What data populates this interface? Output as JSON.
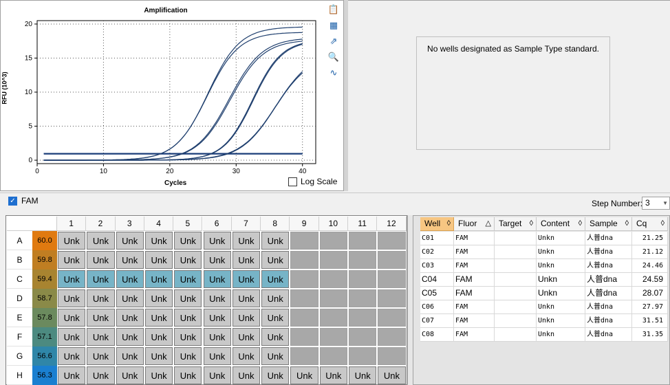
{
  "chart_data": {
    "type": "line",
    "title": "Amplification",
    "xlabel": "Cycles",
    "ylabel": "RFU (10^3)",
    "xlim": [
      0,
      42
    ],
    "ylim": [
      -0.5,
      20.5
    ],
    "xticks": [
      0,
      10,
      20,
      30,
      40
    ],
    "yticks": [
      0,
      5,
      10,
      15,
      20
    ],
    "grid": true,
    "series": [
      {
        "well": "C01",
        "cq": 21.25,
        "plateau": 19.6,
        "slope": 2.4
      },
      {
        "well": "C02",
        "cq": 21.12,
        "plateau": 18.8,
        "slope": 2.4
      },
      {
        "well": "C03",
        "cq": 24.46,
        "plateau": 18.0,
        "slope": 2.5
      },
      {
        "well": "C04",
        "cq": 24.59,
        "plateau": 17.7,
        "slope": 2.5
      },
      {
        "well": "C05",
        "cq": 28.07,
        "plateau": 17.6,
        "slope": 2.2
      },
      {
        "well": "C06",
        "cq": 27.97,
        "plateau": 17.7,
        "slope": 2.2
      },
      {
        "well": "C07",
        "cq": 31.51,
        "plateau": 16.0,
        "slope": 2.7
      },
      {
        "well": "C08",
        "cq": 31.35,
        "plateau": 15.4,
        "slope": 2.6
      }
    ],
    "baselines": [
      1.0,
      1.0,
      0.9
    ],
    "line_color": "#1f3f6e",
    "baseline_color": "#1a3d78"
  },
  "chart_ui": {
    "log_scale_label": "Log Scale",
    "log_scale_checked": false,
    "tools": [
      "copy-icon",
      "chart-type-icon",
      "export-icon",
      "zoom-icon",
      "curve-fit-icon"
    ]
  },
  "standard_panel": {
    "message": "No wells designated as Sample Type standard."
  },
  "fluor_toggle": {
    "label": "FAM",
    "checked": true
  },
  "step": {
    "label": "Step Number:",
    "value": "3"
  },
  "plate": {
    "columns": [
      "1",
      "2",
      "3",
      "4",
      "5",
      "6",
      "7",
      "8",
      "9",
      "10",
      "11",
      "12"
    ],
    "rows": [
      {
        "letter": "A",
        "temp": "60.0",
        "color": "#e07a10",
        "used": 8
      },
      {
        "letter": "B",
        "temp": "59.8",
        "color": "#c07e22",
        "used": 8
      },
      {
        "letter": "C",
        "temp": "59.4",
        "color": "#a88430",
        "used": 8
      },
      {
        "letter": "D",
        "temp": "58.7",
        "color": "#8a8a48",
        "used": 8
      },
      {
        "letter": "E",
        "temp": "57.8",
        "color": "#6b8a5e",
        "used": 8
      },
      {
        "letter": "F",
        "temp": "57.1",
        "color": "#4c8a80",
        "used": 8
      },
      {
        "letter": "G",
        "temp": "56.6",
        "color": "#2f86a8",
        "used": 8
      },
      {
        "letter": "H",
        "temp": "56.3",
        "color": "#1a7fd0",
        "used": 12
      }
    ],
    "well_label": "Unk",
    "selected_row": "C"
  },
  "table": {
    "headers": [
      "Well",
      "Fluor",
      "Target",
      "Content",
      "Sample",
      "Cq"
    ],
    "sorted_column": "Well",
    "rows": [
      [
        "C01",
        "FAM",
        "",
        "Unkn",
        "人普dna",
        "21.25"
      ],
      [
        "C02",
        "FAM",
        "",
        "Unkn",
        "人普dna",
        "21.12"
      ],
      [
        "C03",
        "FAM",
        "",
        "Unkn",
        "人普dna",
        "24.46"
      ],
      [
        "C04",
        "FAM",
        "",
        "Unkn",
        "人普dna",
        "24.59"
      ],
      [
        "C05",
        "FAM",
        "",
        "Unkn",
        "人普dna",
        "28.07"
      ],
      [
        "C06",
        "FAM",
        "",
        "Unkn",
        "人普dna",
        "27.97"
      ],
      [
        "C07",
        "FAM",
        "",
        "Unkn",
        "人普dna",
        "31.51"
      ],
      [
        "C08",
        "FAM",
        "",
        "Unkn",
        "人普dna",
        "31.35"
      ]
    ]
  }
}
